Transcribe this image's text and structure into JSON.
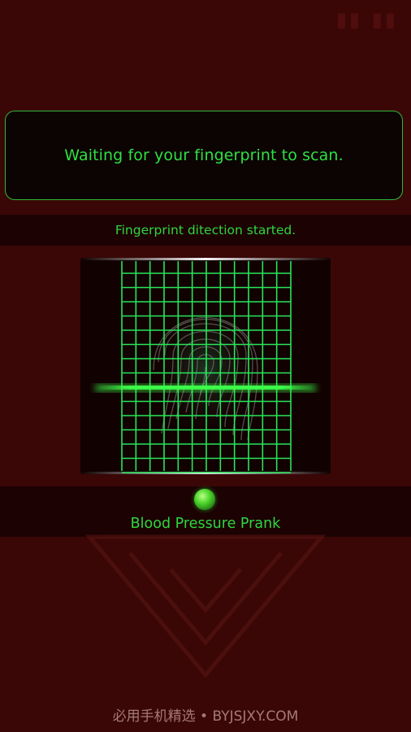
{
  "message_box": {
    "text": "Waiting for your fingerprint to scan."
  },
  "status": {
    "text": "Fingerprint ditection started."
  },
  "scanner": {
    "state": "scanning",
    "grid_color": "#26e65a",
    "scan_line_color": "#3dff4a"
  },
  "indicator": {
    "color": "#4bd32a"
  },
  "app": {
    "title": "Blood Pressure Prank"
  },
  "watermark": {
    "text": "必用手机精选 • BYJSJXY.COM"
  },
  "colors": {
    "background": "#3a0706",
    "accent": "#2ee043"
  }
}
